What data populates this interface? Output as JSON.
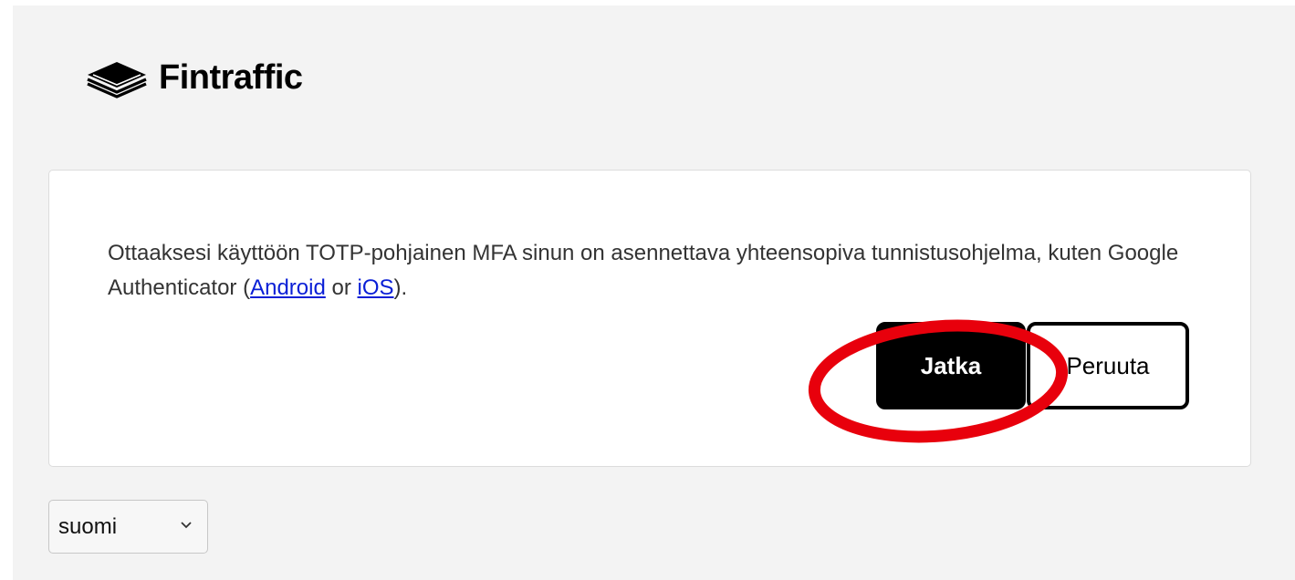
{
  "brand": {
    "name": "Fintraffic"
  },
  "dialog": {
    "message_before": "Ottaaksesi käyttöön TOTP-pohjainen MFA sinun on asennettava yhteensopiva tunnistusohjelma, kuten Google Authenticator (",
    "android_link": "Android",
    "or_text": " or ",
    "ios_link": "iOS",
    "message_after": ").",
    "continue_label": "Jatka",
    "cancel_label": "Peruuta"
  },
  "language": {
    "selected": "suomi"
  },
  "colors": {
    "page_background": "#f3f3f3",
    "card_background": "#ffffff",
    "primary_button": "#000000",
    "link": "#0a1fd6",
    "highlight_ring": "#e8000c"
  },
  "icons": {
    "logo": "fintraffic-layers-logo-icon",
    "select_arrow": "chevron-down-icon",
    "annotation": "red-ellipse-highlight"
  }
}
